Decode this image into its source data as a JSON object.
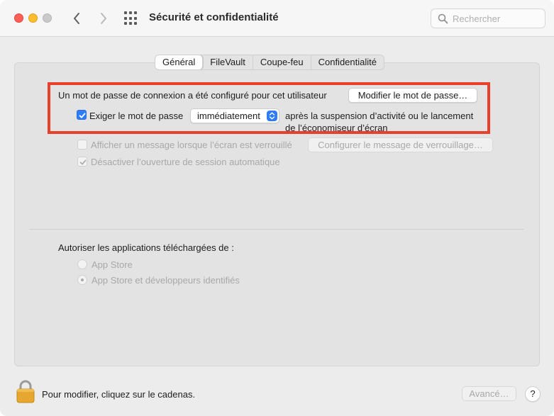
{
  "window": {
    "title": "Sécurité et confidentialité"
  },
  "toolbar": {
    "back_icon": "chevron-left-icon",
    "forward_icon": "chevron-right-icon",
    "grid_icon": "show-all-grid-icon"
  },
  "search": {
    "placeholder": "Rechercher",
    "value": ""
  },
  "tabs": [
    {
      "label": "Général",
      "active": true
    },
    {
      "label": "FileVault",
      "active": false
    },
    {
      "label": "Coupe-feu",
      "active": false
    },
    {
      "label": "Confidentialité",
      "active": false
    }
  ],
  "general": {
    "password_text": "Un mot de passe de connexion a été configuré pour cet utilisateur",
    "change_password_button": "Modifier le mot de passe…",
    "require_password": {
      "label": "Exiger le mot de passe",
      "checked": true,
      "selected_value": "immédiatement",
      "after_line1": "après la suspension d’activité ou le lancement",
      "after_line2": "de l’économiseur d’écran"
    },
    "show_message": {
      "label": "Afficher un message lorsque l’écran est verrouillé",
      "checked": false,
      "enabled": false,
      "button": "Configurer le message de verrouillage…"
    },
    "disable_autologin": {
      "label": "Désactiver l’ouverture de session automatique",
      "checked": true,
      "enabled": false
    },
    "allow_apps_heading": "Autoriser les applications téléchargées de :",
    "radio_options": [
      {
        "label": "App Store",
        "selected": false
      },
      {
        "label": "App Store et développeurs identifiés",
        "selected": true
      }
    ]
  },
  "footer": {
    "lock_text": "Pour modifier, cliquez sur le cadenas.",
    "advanced_button": "Avancé…",
    "help_button": "?"
  },
  "colors": {
    "accent": "#2e7cf6",
    "highlight_border": "#e8402a",
    "traffic_red": "#ff5f57",
    "traffic_yellow": "#febc2e"
  }
}
